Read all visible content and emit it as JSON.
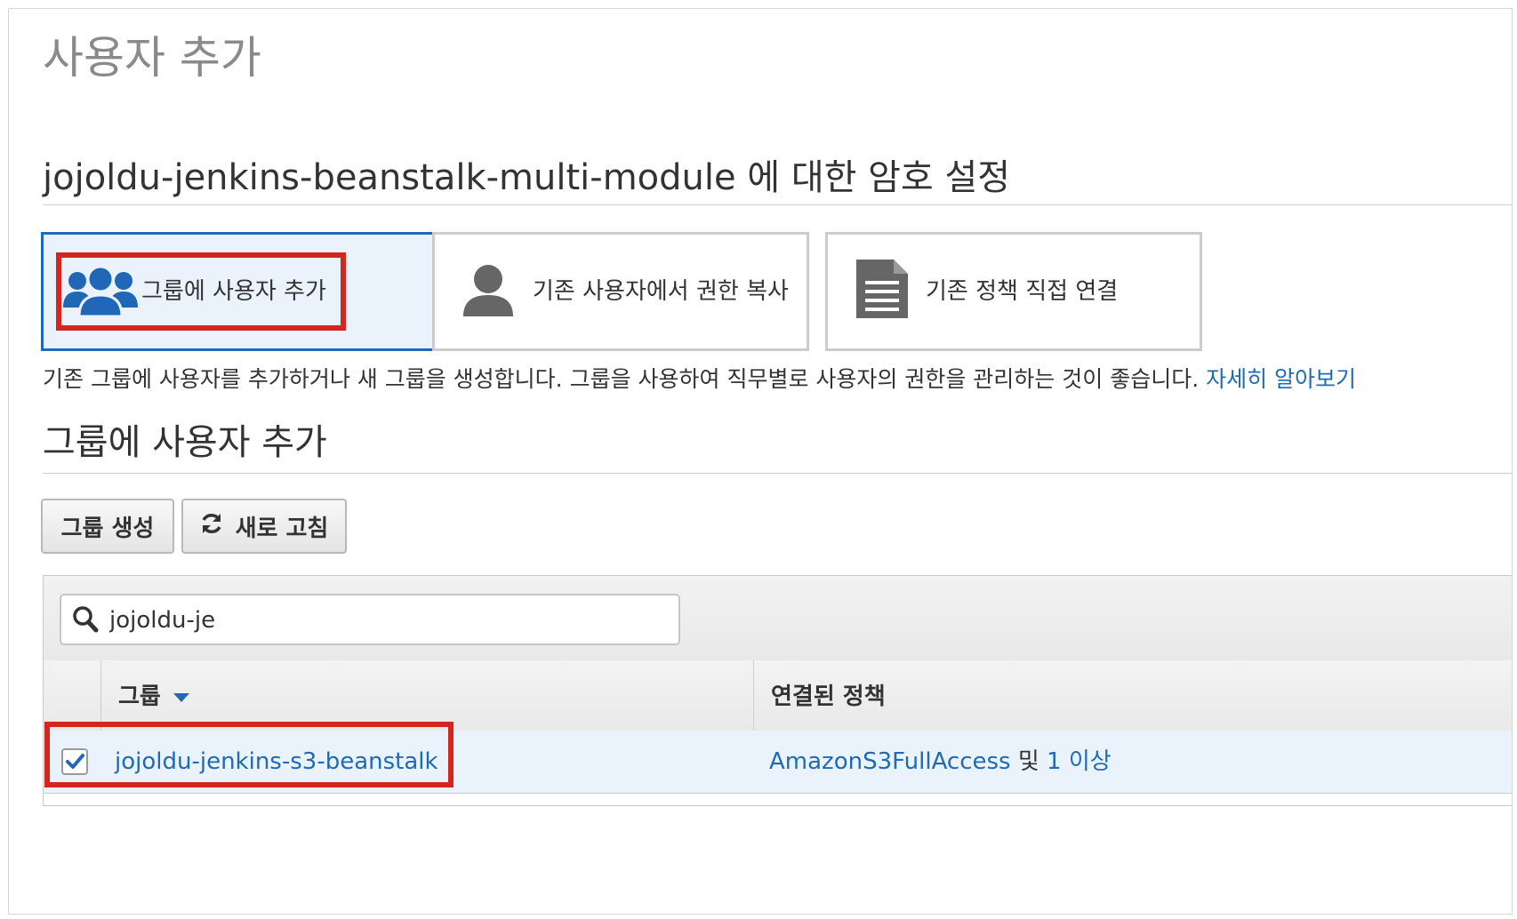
{
  "page": {
    "title": "사용자 추가",
    "section_title": "jojoldu-jenkins-beanstalk-multi-module 에 대한 암호 설정"
  },
  "permission_options": [
    {
      "label": "그룹에 사용자 추가",
      "icon": "users-group-icon",
      "selected": true
    },
    {
      "label": "기존 사용자에서 권한 복사",
      "icon": "user-icon",
      "selected": false
    },
    {
      "label": "기존 정책 직접 연결",
      "icon": "document-icon",
      "selected": false
    }
  ],
  "description": {
    "text": "기존 그룹에 사용자를 추가하거나 새 그룹을 생성합니다. 그룹을 사용하여 직무별로 사용자의 권한을 관리하는 것이 좋습니다.",
    "link": "자세히 알아보기"
  },
  "group_section": {
    "title": "그룹에 사용자 추가",
    "create_button": "그룹 생성",
    "refresh_button": "새로 고침"
  },
  "search": {
    "value": "jojoldu-je"
  },
  "table": {
    "columns": [
      "그룹",
      "연결된 정책"
    ],
    "sort_column": "그룹",
    "rows": [
      {
        "checked": true,
        "group": "jojoldu-jenkins-s3-beanstalk",
        "policy": "AmazonS3FullAccess",
        "policy_joiner": "및",
        "policy_more": "1 이상"
      }
    ]
  },
  "colors": {
    "accent": "#2167b8",
    "link": "#1f6ab4",
    "highlight": "#d2261f",
    "selected_bg": "#eaf3fb"
  }
}
